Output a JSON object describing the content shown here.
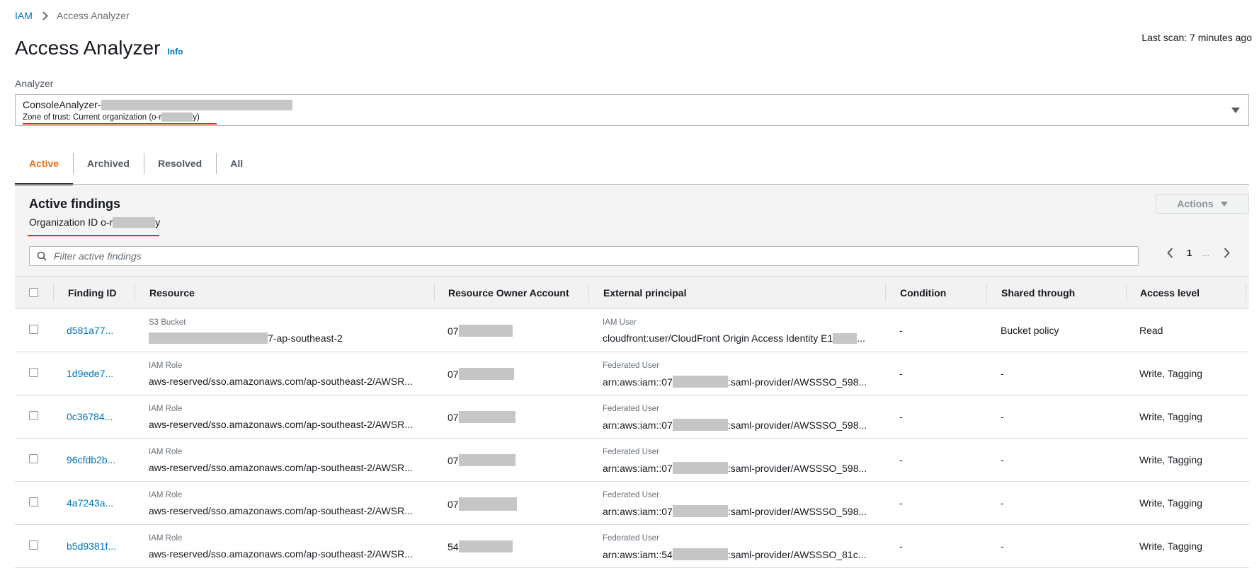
{
  "breadcrumb": {
    "root": "IAM",
    "current": "Access Analyzer"
  },
  "header": {
    "title": "Access Analyzer",
    "info": "Info",
    "last_scan": "Last scan: 7 minutes ago"
  },
  "analyzer": {
    "label": "Analyzer",
    "name_prefix": "ConsoleAnalyzer-",
    "zone_prefix": "Zone of trust: Current organization (o-r",
    "zone_suffix": "y)"
  },
  "tabs": [
    {
      "label": "Active",
      "active": true
    },
    {
      "label": "Archived",
      "active": false
    },
    {
      "label": "Resolved",
      "active": false
    },
    {
      "label": "All",
      "active": false
    }
  ],
  "findings": {
    "title": "Active findings",
    "org_prefix": "Organization ID o-r",
    "org_suffix": "y",
    "actions_label": "Actions",
    "filter_placeholder": "Filter active findings",
    "page": "1",
    "page_dots": "..."
  },
  "table": {
    "columns": [
      "Finding ID",
      "Resource",
      "Resource Owner Account",
      "External principal",
      "Condition",
      "Shared through",
      "Access level"
    ],
    "rows": [
      {
        "id": "d581a77...",
        "res_type": "S3 Bucket",
        "res_main": "",
        "res_tail": "7-ap-southeast-2",
        "owner": "07",
        "princ_type": "IAM User",
        "princ_pre": "cloudfront:user/CloudFront Origin Access Identity E1",
        "princ_post": "...",
        "condition": "-",
        "shared": "Bucket policy",
        "access": "Read"
      },
      {
        "id": "1d9ede7...",
        "res_type": "IAM Role",
        "res_main": "aws-reserved/sso.amazonaws.com/ap-southeast-2/AWSR...",
        "res_tail": "",
        "owner": "07",
        "princ_type": "Federated User",
        "princ_pre": "arn:aws:iam::07",
        "princ_post": ":saml-provider/AWSSSO_598...",
        "condition": "-",
        "shared": "-",
        "access": "Write, Tagging"
      },
      {
        "id": "0c36784...",
        "res_type": "IAM Role",
        "res_main": "aws-reserved/sso.amazonaws.com/ap-southeast-2/AWSR...",
        "res_tail": "",
        "owner": "07",
        "princ_type": "Federated User",
        "princ_pre": "arn:aws:iam::07",
        "princ_post": ":saml-provider/AWSSSO_598...",
        "condition": "-",
        "shared": "-",
        "access": "Write, Tagging"
      },
      {
        "id": "96cfdb2b...",
        "res_type": "IAM Role",
        "res_main": "aws-reserved/sso.amazonaws.com/ap-southeast-2/AWSR...",
        "res_tail": "",
        "owner": "07",
        "princ_type": "Federated User",
        "princ_pre": "arn:aws:iam::07",
        "princ_post": ":saml-provider/AWSSSO_598...",
        "condition": "-",
        "shared": "-",
        "access": "Write, Tagging"
      },
      {
        "id": "4a7243a...",
        "res_type": "IAM Role",
        "res_main": "aws-reserved/sso.amazonaws.com/ap-southeast-2/AWSR...",
        "res_tail": "",
        "owner": "07",
        "princ_type": "Federated User",
        "princ_pre": "arn:aws:iam::07",
        "princ_post": ":saml-provider/AWSSSO_598...",
        "condition": "-",
        "shared": "-",
        "access": "Write, Tagging"
      },
      {
        "id": "b5d9381f...",
        "res_type": "IAM Role",
        "res_main": "aws-reserved/sso.amazonaws.com/ap-southeast-2/AWSR...",
        "res_tail": "",
        "owner": "54",
        "princ_type": "Federated User",
        "princ_pre": "arn:aws:iam::54",
        "princ_post": ":saml-provider/AWSSSO_81c...",
        "condition": "-",
        "shared": "-",
        "access": "Write, Tagging"
      }
    ]
  },
  "colors": {
    "link": "#0073bb",
    "active_tab": "#ec7211",
    "highlight": "#d13212"
  }
}
